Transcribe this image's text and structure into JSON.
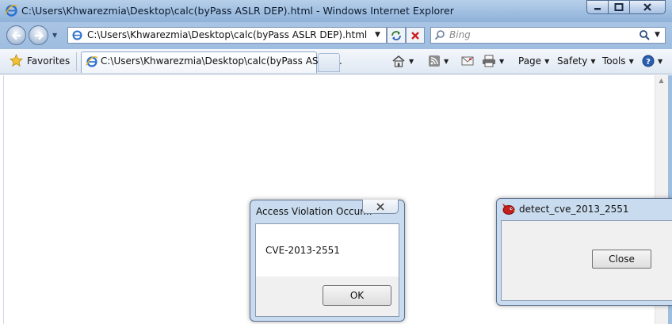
{
  "window": {
    "title": "C:\\Users\\Khwarezmia\\Desktop\\calc(byPass ASLR DEP).html - Windows Internet Explorer",
    "controls": {
      "minimize": "minimize-icon",
      "maximize": "maximize-icon",
      "close": "close-icon"
    }
  },
  "address_bar": {
    "url": "C:\\Users\\Khwarezmia\\Desktop\\calc(byPass ASLR DEP).html"
  },
  "search": {
    "placeholder": "Bing"
  },
  "favorites_bar": {
    "favorites_label": "Favorites",
    "tab_title": "C:\\Users\\Khwarezmia\\Desktop\\calc(byPass ASLR ..."
  },
  "command_bar": {
    "page_label": "Page",
    "safety_label": "Safety",
    "tools_label": "Tools"
  },
  "dialogs": {
    "access_violation": {
      "title": "Access Violation Occur...",
      "message": "CVE-2013-2551",
      "ok_label": "OK"
    },
    "detect": {
      "title": "detect_cve_2013_2551",
      "close_label": "Close"
    }
  },
  "colors": {
    "frame": "#9ebddf",
    "stop_red": "#d01f1f",
    "content_bg": "#ffffff"
  }
}
